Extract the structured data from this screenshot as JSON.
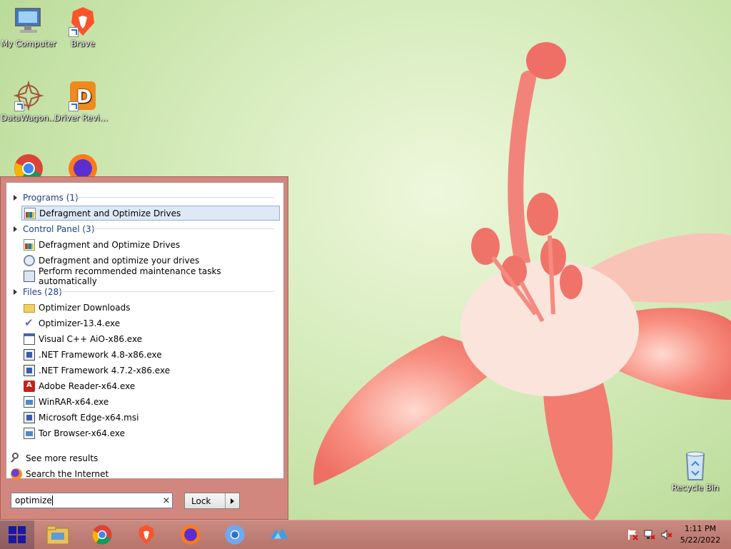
{
  "desktop": {
    "icons": [
      {
        "label": "My Computer"
      },
      {
        "label": "Brave"
      },
      {
        "label": "DataWagon..."
      },
      {
        "label": "Driver Reviver"
      },
      {
        "label": "Recycle Bin"
      }
    ]
  },
  "start_menu": {
    "groups": [
      {
        "header": "Programs (1)",
        "items": [
          "Defragment and Optimize Drives"
        ]
      },
      {
        "header": "Control Panel (3)",
        "items": [
          "Defragment and Optimize Drives",
          "Defragment and optimize your drives",
          "Perform recommended maintenance tasks automatically"
        ]
      },
      {
        "header": "Files (28)",
        "items": [
          "Optimizer Downloads",
          "Optimizer-13.4.exe",
          "Visual C++ AiO-x86.exe",
          ".NET Framework 4.8-x86.exe",
          ".NET Framework 4.7.2-x86.exe",
          "Adobe Reader-x64.exe",
          "WinRAR-x64.exe",
          "Microsoft Edge-x64.msi",
          "Tor Browser-x64.exe"
        ]
      }
    ],
    "see_more": "See more results",
    "search_internet": "Search the Internet",
    "search": {
      "value": "optimize",
      "clear": "×"
    },
    "lock_label": "Lock"
  },
  "taskbar": {
    "clock_time": "1:11 PM",
    "clock_date": "5/22/2022"
  },
  "colors": {
    "menu_frame": "#d2877e",
    "taskbar": "#c98b82",
    "selection": "#dfe9f6"
  }
}
